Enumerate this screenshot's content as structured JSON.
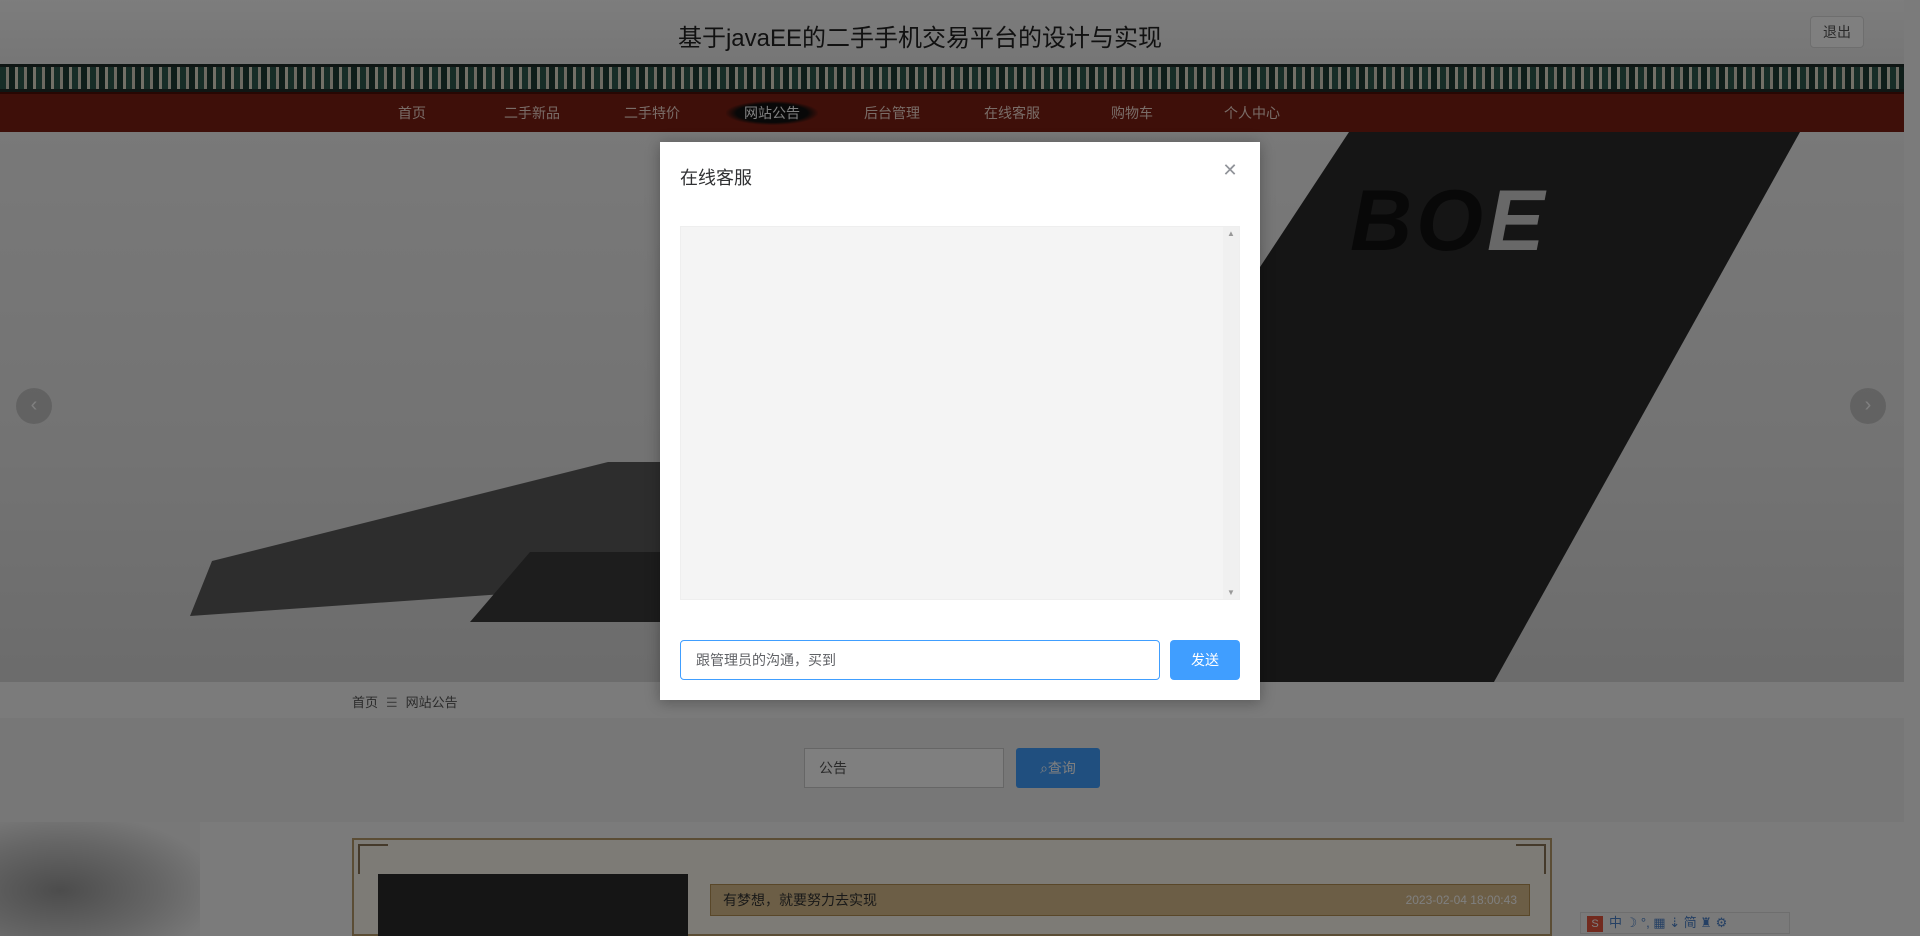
{
  "header": {
    "title": "基于javaEE的二手手机交易平台的设计与实现",
    "logout_label": "退出"
  },
  "nav": {
    "items": [
      {
        "label": "首页"
      },
      {
        "label": "二手新品"
      },
      {
        "label": "二手特价"
      },
      {
        "label": "网站公告",
        "active": true
      },
      {
        "label": "后台管理"
      },
      {
        "label": "在线客服"
      },
      {
        "label": "购物车"
      },
      {
        "label": "个人中心"
      }
    ]
  },
  "banner": {
    "brand_text_a": "BO",
    "brand_text_b": "E",
    "prev_icon": "chevron-left-icon",
    "next_icon": "chevron-right-icon"
  },
  "breadcrumb": {
    "home": "首页",
    "separator": "☰",
    "current": "网站公告"
  },
  "search": {
    "value": "公告",
    "button_label": "查询",
    "button_icon": "search-icon"
  },
  "notice": {
    "title": "有梦想，就要努力去实现",
    "date": "2023-02-04 18:00:43"
  },
  "ime_bar": {
    "label": "中 ☽ °, ▦ ⇣ 简 ♜ ⚙"
  },
  "dialog": {
    "title": "在线客服",
    "close_icon": "close-icon",
    "message_value": "跟管理员的沟通，买到",
    "send_label": "发送"
  },
  "colors": {
    "primary": "#409eff",
    "nav_bg": "#7c1e12",
    "overlay": "rgba(0,0,0,0.5)"
  }
}
